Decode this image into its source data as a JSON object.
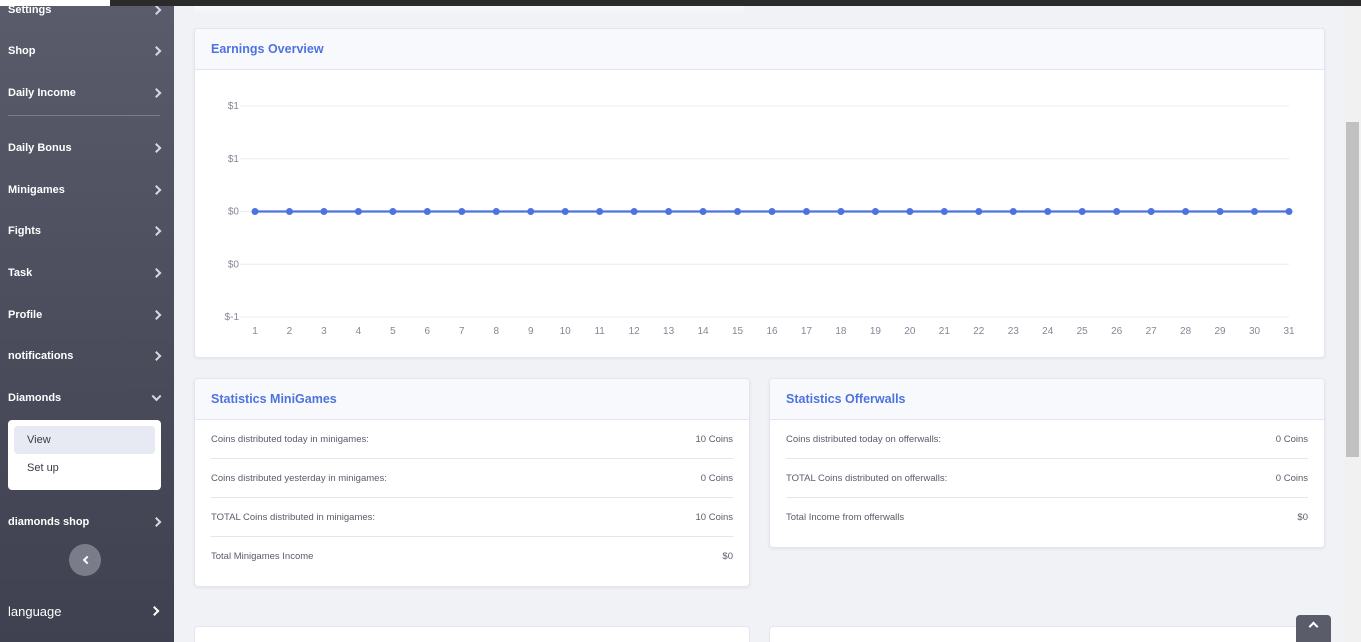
{
  "sidebar": {
    "items": [
      {
        "label": "Settings"
      },
      {
        "label": "Shop"
      },
      {
        "label": "Daily Income"
      },
      {
        "label": "Daily Bonus"
      },
      {
        "label": "Minigames"
      },
      {
        "label": "Fights"
      },
      {
        "label": "Task"
      },
      {
        "label": "Profile"
      },
      {
        "label": "notifications"
      },
      {
        "label": "Diamonds"
      },
      {
        "label": "diamonds shop"
      }
    ],
    "diamonds_sub": [
      {
        "label": "View"
      },
      {
        "label": "Set up"
      }
    ],
    "language": "language"
  },
  "earnings": {
    "title": "Earnings Overview"
  },
  "chart_data": {
    "type": "line",
    "title": "",
    "xlabel": "",
    "ylabel": "",
    "x": [
      1,
      2,
      3,
      4,
      5,
      6,
      7,
      8,
      9,
      10,
      11,
      12,
      13,
      14,
      15,
      16,
      17,
      18,
      19,
      20,
      21,
      22,
      23,
      24,
      25,
      26,
      27,
      28,
      29,
      30,
      31
    ],
    "x_tick_labels": [
      "1",
      "2",
      "3",
      "4",
      "5",
      "6",
      "7",
      "8",
      "9",
      "10",
      "11",
      "12",
      "13",
      "14",
      "15",
      "16",
      "17",
      "18",
      "19",
      "20",
      "21",
      "22",
      "23",
      "24",
      "25",
      "26",
      "27",
      "28",
      "29",
      "30",
      "31"
    ],
    "series": [
      {
        "values": [
          0,
          0,
          0,
          0,
          0,
          0,
          0,
          0,
          0,
          0,
          0,
          0,
          0,
          0,
          0,
          0,
          0,
          0,
          0,
          0,
          0,
          0,
          0,
          0,
          0,
          0,
          0,
          0,
          0,
          0,
          0
        ],
        "color": "#4e73df"
      }
    ],
    "ylim": [
      -1,
      1
    ],
    "y_ticks": [
      1,
      0.5,
      0,
      -0.5,
      -1
    ],
    "y_tick_labels": [
      "$1",
      "$1",
      "$0",
      "$0",
      "$-1"
    ],
    "grid": true
  },
  "minigames": {
    "title": "Statistics MiniGames",
    "rows": [
      {
        "label": "Coins distributed today in minigames:",
        "value": "10 Coins"
      },
      {
        "label": "Coins distributed yesterday in minigames:",
        "value": "0 Coins"
      },
      {
        "label": "TOTAL Coins distributed in minigames:",
        "value": "10 Coins"
      },
      {
        "label": "Total Minigames Income",
        "value": "$0"
      }
    ]
  },
  "offerwalls": {
    "title": "Statistics Offerwalls",
    "rows": [
      {
        "label": "Coins distributed today on offerwalls:",
        "value": "0 Coins"
      },
      {
        "label": "TOTAL Coins distributed on offerwalls:",
        "value": "0 Coins"
      },
      {
        "label": "Total Income from offerwalls",
        "value": "$0"
      }
    ]
  },
  "colors": {
    "accent": "#4e73df",
    "sidebar": "#4a4c5b"
  }
}
